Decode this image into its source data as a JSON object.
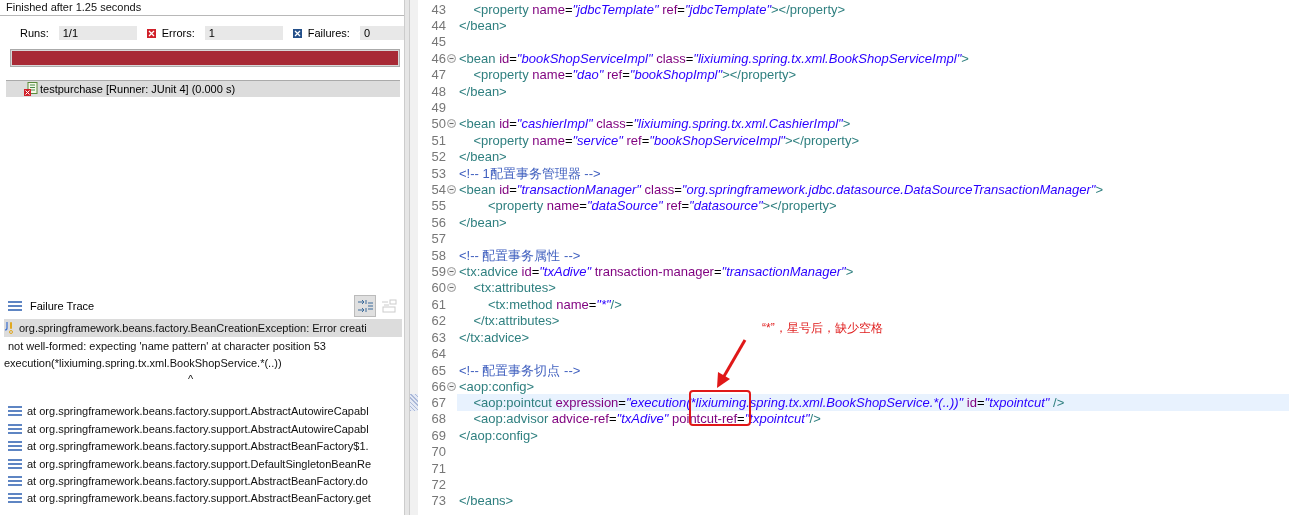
{
  "junit": {
    "status": "Finished after 1.25 seconds",
    "counters": [
      {
        "kind": "runs",
        "label": "Runs:",
        "value": "1/1"
      },
      {
        "kind": "errors",
        "label": "Errors:",
        "value": "1"
      },
      {
        "kind": "failures",
        "label": "Failures:",
        "value": "0"
      }
    ],
    "progress": {
      "level": 1,
      "failed": true
    },
    "tests": [
      {
        "label": "testpurchase [Runner: JUnit 4] (0.000 s)",
        "selected": true
      }
    ]
  },
  "failure_trace": {
    "title": "Failure Trace",
    "lines": [
      {
        "kind": "exception",
        "text": "org.springframework.beans.factory.BeanCreationException: Error creati",
        "selected": true
      },
      {
        "kind": "message",
        "text": "not well-formed: expecting 'name pattern' at character position 53",
        "selected": false
      },
      {
        "kind": "plain",
        "text": "execution(*lixiuming.spring.tx.xml.BookShopService.*(..))",
        "selected": false
      },
      {
        "kind": "caret",
        "text": "^",
        "selected": false
      },
      {
        "kind": "stack",
        "text": "at org.springframework.beans.factory.support.AbstractAutowireCapabl",
        "selected": false
      },
      {
        "kind": "stack",
        "text": "at org.springframework.beans.factory.support.AbstractAutowireCapabl",
        "selected": false
      },
      {
        "kind": "stack",
        "text": "at org.springframework.beans.factory.support.AbstractBeanFactory$1.",
        "selected": false
      },
      {
        "kind": "stack",
        "text": "at org.springframework.beans.factory.support.DefaultSingletonBeanRe",
        "selected": false
      },
      {
        "kind": "stack",
        "text": "at org.springframework.beans.factory.support.AbstractBeanFactory.do",
        "selected": false
      },
      {
        "kind": "stack",
        "text": "at org.springframework.beans.factory.support.AbstractBeanFactory.get",
        "selected": false
      }
    ]
  },
  "editor": {
    "lines": [
      {
        "number": "43",
        "foldable": false,
        "current": false,
        "tokens": [
          {
            "kind": "tag",
            "text": "    <property"
          },
          {
            "kind": "attr",
            "text": " name"
          },
          {
            "kind": "eq",
            "text": "="
          },
          {
            "kind": "value",
            "text": "\"jdbcTemplate\""
          },
          {
            "kind": "attr",
            "text": " ref"
          },
          {
            "kind": "eq",
            "text": "="
          },
          {
            "kind": "value",
            "text": "\"jdbcTemplate\""
          },
          {
            "kind": "tag",
            "text": "></property>"
          }
        ]
      },
      {
        "number": "44",
        "foldable": false,
        "current": false,
        "tokens": [
          {
            "kind": "tag",
            "text": "</bean>"
          }
        ]
      },
      {
        "number": "45",
        "foldable": false,
        "current": false
      },
      {
        "number": "46",
        "foldable": true,
        "current": false,
        "tokens": [
          {
            "kind": "tag",
            "text": "<bean"
          },
          {
            "kind": "attr",
            "text": " id"
          },
          {
            "kind": "eq",
            "text": "="
          },
          {
            "kind": "value",
            "text": "\"bookShopServiceImpl\""
          },
          {
            "kind": "attr",
            "text": " class"
          },
          {
            "kind": "eq",
            "text": "="
          },
          {
            "kind": "value",
            "text": "\"lixiuming.spring.tx.xml.BookShopServiceImpl\""
          },
          {
            "kind": "tag",
            "text": ">"
          }
        ]
      },
      {
        "number": "47",
        "foldable": false,
        "current": false,
        "tokens": [
          {
            "kind": "tag",
            "text": "    <property"
          },
          {
            "kind": "attr",
            "text": " name"
          },
          {
            "kind": "eq",
            "text": "="
          },
          {
            "kind": "value",
            "text": "\"dao\""
          },
          {
            "kind": "attr",
            "text": " ref"
          },
          {
            "kind": "eq",
            "text": "="
          },
          {
            "kind": "value",
            "text": "\"bookShopImpl\""
          },
          {
            "kind": "tag",
            "text": "></property>"
          }
        ]
      },
      {
        "number": "48",
        "foldable": false,
        "current": false,
        "tokens": [
          {
            "kind": "tag",
            "text": "</bean>"
          }
        ]
      },
      {
        "number": "49",
        "foldable": false,
        "current": false
      },
      {
        "number": "50",
        "foldable": true,
        "current": false,
        "tokens": [
          {
            "kind": "tag",
            "text": "<bean"
          },
          {
            "kind": "attr",
            "text": " id"
          },
          {
            "kind": "eq",
            "text": "="
          },
          {
            "kind": "value",
            "text": "\"cashierImpl\""
          },
          {
            "kind": "attr",
            "text": " class"
          },
          {
            "kind": "eq",
            "text": "="
          },
          {
            "kind": "value",
            "text": "\"lixiuming.spring.tx.xml.CashierImpl\""
          },
          {
            "kind": "tag",
            "text": ">"
          }
        ]
      },
      {
        "number": "51",
        "foldable": false,
        "current": false,
        "tokens": [
          {
            "kind": "tag",
            "text": "    <property"
          },
          {
            "kind": "attr",
            "text": " name"
          },
          {
            "kind": "eq",
            "text": "="
          },
          {
            "kind": "value",
            "text": "\"service\""
          },
          {
            "kind": "attr",
            "text": " ref"
          },
          {
            "kind": "eq",
            "text": "="
          },
          {
            "kind": "value",
            "text": "\"bookShopServiceImpl\""
          },
          {
            "kind": "tag",
            "text": "></property>"
          }
        ]
      },
      {
        "number": "52",
        "foldable": false,
        "current": false,
        "tokens": [
          {
            "kind": "tag",
            "text": "</bean>"
          }
        ]
      },
      {
        "number": "53",
        "foldable": false,
        "current": false,
        "tokens": [
          {
            "kind": "comment",
            "text": "<!-- 1配置事务管理器 -->"
          }
        ]
      },
      {
        "number": "54",
        "foldable": true,
        "current": false,
        "tokens": [
          {
            "kind": "tag",
            "text": "<bean"
          },
          {
            "kind": "attr",
            "text": " id"
          },
          {
            "kind": "eq",
            "text": "="
          },
          {
            "kind": "value",
            "text": "\"transactionManager\""
          },
          {
            "kind": "attr",
            "text": " class"
          },
          {
            "kind": "eq",
            "text": "="
          },
          {
            "kind": "value",
            "text": "\"org.springframework.jdbc.datasource.DataSourceTransactionManager\""
          },
          {
            "kind": "tag",
            "text": ">"
          }
        ]
      },
      {
        "number": "55",
        "foldable": false,
        "current": false,
        "tokens": [
          {
            "kind": "tag",
            "text": "        <property"
          },
          {
            "kind": "attr",
            "text": " name"
          },
          {
            "kind": "eq",
            "text": "="
          },
          {
            "kind": "value",
            "text": "\"dataSource\""
          },
          {
            "kind": "attr",
            "text": " ref"
          },
          {
            "kind": "eq",
            "text": "="
          },
          {
            "kind": "value",
            "text": "\"datasource\""
          },
          {
            "kind": "tag",
            "text": "></property>"
          }
        ]
      },
      {
        "number": "56",
        "foldable": false,
        "current": false,
        "tokens": [
          {
            "kind": "tag",
            "text": "</bean>"
          }
        ]
      },
      {
        "number": "57",
        "foldable": false,
        "current": false
      },
      {
        "number": "58",
        "foldable": false,
        "current": false,
        "tokens": [
          {
            "kind": "comment",
            "text": "<!-- 配置事务属性 -->"
          }
        ]
      },
      {
        "number": "59",
        "foldable": true,
        "current": false,
        "tokens": [
          {
            "kind": "tag",
            "text": "<tx:advice"
          },
          {
            "kind": "attr",
            "text": " id"
          },
          {
            "kind": "eq",
            "text": "="
          },
          {
            "kind": "value",
            "text": "\"txAdive\""
          },
          {
            "kind": "attr",
            "text": " transaction-manager"
          },
          {
            "kind": "eq",
            "text": "="
          },
          {
            "kind": "value",
            "text": "\"transactionManager\""
          },
          {
            "kind": "tag",
            "text": ">"
          }
        ]
      },
      {
        "number": "60",
        "foldable": true,
        "current": false,
        "tokens": [
          {
            "kind": "tag",
            "text": "    <tx:attributes>"
          }
        ]
      },
      {
        "number": "61",
        "foldable": false,
        "current": false,
        "tokens": [
          {
            "kind": "tag",
            "text": "        <tx:method"
          },
          {
            "kind": "attr",
            "text": " name"
          },
          {
            "kind": "eq",
            "text": "="
          },
          {
            "kind": "value",
            "text": "\"*\""
          },
          {
            "kind": "tag",
            "text": "/>"
          }
        ]
      },
      {
        "number": "62",
        "foldable": false,
        "current": false,
        "tokens": [
          {
            "kind": "tag",
            "text": "    </tx:attributes>"
          }
        ]
      },
      {
        "number": "63",
        "foldable": false,
        "current": false,
        "tokens": [
          {
            "kind": "tag",
            "text": "</tx:advice>"
          }
        ]
      },
      {
        "number": "64",
        "foldable": false,
        "current": false
      },
      {
        "number": "65",
        "foldable": false,
        "current": false,
        "tokens": [
          {
            "kind": "comment",
            "text": "<!-- 配置事务切点 -->"
          }
        ]
      },
      {
        "number": "66",
        "foldable": true,
        "current": false,
        "tokens": [
          {
            "kind": "tag",
            "text": "<aop:config>"
          }
        ]
      },
      {
        "number": "67",
        "foldable": false,
        "current": true,
        "tokens": [
          {
            "kind": "tag",
            "text": "    <aop:pointcut"
          },
          {
            "kind": "attr",
            "text": " expression"
          },
          {
            "kind": "eq",
            "text": "="
          },
          {
            "kind": "value",
            "text": "\"execution(*lixiuming.spring.tx.xml.BookShopService.*(..))\""
          },
          {
            "kind": "attr",
            "text": " id"
          },
          {
            "kind": "eq",
            "text": "="
          },
          {
            "kind": "value",
            "text": "\"txpointcut\""
          },
          {
            "kind": "tag",
            "text": " />"
          }
        ]
      },
      {
        "number": "68",
        "foldable": false,
        "current": false,
        "tokens": [
          {
            "kind": "tag",
            "text": "    <aop:advisor"
          },
          {
            "kind": "attr",
            "text": " advice-ref"
          },
          {
            "kind": "eq",
            "text": "="
          },
          {
            "kind": "value",
            "text": "\"txAdive\""
          },
          {
            "kind": "attr",
            "text": " pointcut-ref"
          },
          {
            "kind": "eq",
            "text": "="
          },
          {
            "kind": "value",
            "text": "\"txpointcut\""
          },
          {
            "kind": "tag",
            "text": "/>"
          }
        ]
      },
      {
        "number": "69",
        "foldable": false,
        "current": false,
        "tokens": [
          {
            "kind": "tag",
            "text": "</aop:config>"
          }
        ]
      },
      {
        "number": "70",
        "foldable": false,
        "current": false
      },
      {
        "number": "71",
        "foldable": false,
        "current": false
      },
      {
        "number": "72",
        "foldable": false,
        "current": false
      },
      {
        "number": "73",
        "foldable": false,
        "current": false,
        "tokens": [
          {
            "kind": "tag",
            "text": "</beans>"
          }
        ]
      }
    ]
  },
  "annotation": {
    "text": "“*”，星号后，缺少空格"
  }
}
